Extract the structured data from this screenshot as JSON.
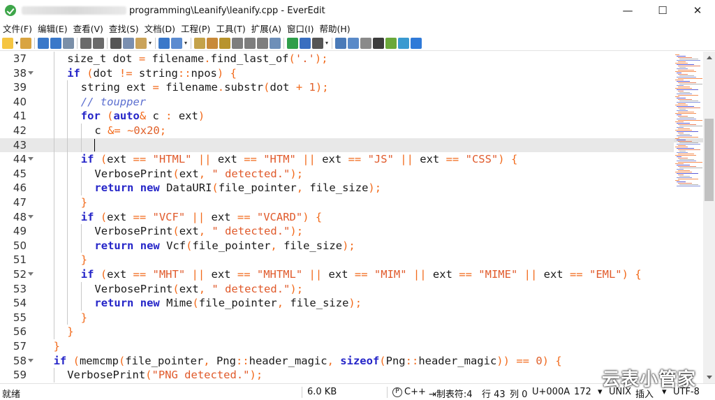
{
  "window": {
    "title": "programming\\Leanify\\leanify.cpp - EverEdit",
    "minimize_glyph": "—",
    "maximize_glyph": "☐",
    "close_glyph": "✕"
  },
  "menu": [
    {
      "label": "文件(F)"
    },
    {
      "label": "编辑(E)"
    },
    {
      "label": "查看(V)"
    },
    {
      "label": "查找(S)"
    },
    {
      "label": "文档(D)"
    },
    {
      "label": "工程(P)"
    },
    {
      "label": "工具(T)"
    },
    {
      "label": "扩展(A)"
    },
    {
      "label": "窗口(I)"
    },
    {
      "label": "帮助(H)"
    }
  ],
  "toolbar_icons": [
    "new-file-icon",
    "open-icon",
    "save-icon",
    "save-all-icon",
    "close-file-icon",
    "undo-icon",
    "redo-icon",
    "cut-icon",
    "copy-icon",
    "paste-icon",
    "indent-icon",
    "list-icon",
    "find-icon",
    "replace-icon",
    "find-in-files-icon",
    "macro-record-icon",
    "macro-play-icon",
    "macro-stop-icon",
    "column-icon",
    "run-icon",
    "run-script-icon",
    "tools-icon",
    "view-icon",
    "split-icon",
    "document-icon",
    "terminal-icon",
    "hex-icon",
    "browser-icon",
    "help-icon"
  ],
  "colors": {
    "keyword": "#2525c8",
    "operator": "#f26a1b",
    "string": "#e05a2b",
    "comment": "#5c6fd0",
    "current_line": "#e8e8e8"
  },
  "code_lines": [
    {
      "n": "37",
      "fold": false,
      "current": false,
      "indent": 2,
      "tokens": [
        [
          "pl",
          "size_t dot "
        ],
        [
          "op",
          "="
        ],
        [
          "pl",
          " filename"
        ],
        [
          "pu",
          "."
        ],
        [
          "fn",
          "find_last_of"
        ],
        [
          "br",
          "("
        ],
        [
          "str",
          "'.'"
        ],
        [
          "br",
          ")"
        ],
        [
          "pu",
          ";"
        ]
      ]
    },
    {
      "n": "38",
      "fold": true,
      "current": false,
      "indent": 2,
      "tokens": [
        [
          "kw",
          "if"
        ],
        [
          "pl",
          " "
        ],
        [
          "br",
          "("
        ],
        [
          "pl",
          "dot "
        ],
        [
          "op",
          "!="
        ],
        [
          "pl",
          " string"
        ],
        [
          "pu",
          "::"
        ],
        [
          "pl",
          "npos"
        ],
        [
          "br",
          ")"
        ],
        [
          "pl",
          " "
        ],
        [
          "br",
          "{"
        ]
      ]
    },
    {
      "n": "39",
      "fold": false,
      "current": false,
      "indent": 3,
      "tokens": [
        [
          "pl",
          "string ext "
        ],
        [
          "op",
          "="
        ],
        [
          "pl",
          " filename"
        ],
        [
          "pu",
          "."
        ],
        [
          "fn",
          "substr"
        ],
        [
          "br",
          "("
        ],
        [
          "pl",
          "dot "
        ],
        [
          "op",
          "+"
        ],
        [
          "pl",
          " "
        ],
        [
          "num",
          "1"
        ],
        [
          "br",
          ")"
        ],
        [
          "pu",
          ";"
        ]
      ]
    },
    {
      "n": "40",
      "fold": false,
      "current": false,
      "indent": 3,
      "tokens": [
        [
          "cm",
          "// toupper"
        ]
      ]
    },
    {
      "n": "41",
      "fold": false,
      "current": false,
      "indent": 3,
      "tokens": [
        [
          "kw",
          "for"
        ],
        [
          "pl",
          " "
        ],
        [
          "br",
          "("
        ],
        [
          "kw",
          "auto"
        ],
        [
          "op",
          "&"
        ],
        [
          "pl",
          " c "
        ],
        [
          "op",
          ":"
        ],
        [
          "pl",
          " ext"
        ],
        [
          "br",
          ")"
        ]
      ]
    },
    {
      "n": "42",
      "fold": false,
      "current": false,
      "indent": 4,
      "tokens": [
        [
          "pl",
          "c "
        ],
        [
          "op",
          "&="
        ],
        [
          "pl",
          " "
        ],
        [
          "op",
          "~"
        ],
        [
          "num",
          "0x20"
        ],
        [
          "pu",
          ";"
        ]
      ]
    },
    {
      "n": "43",
      "fold": false,
      "current": true,
      "indent": 4,
      "tokens": []
    },
    {
      "n": "44",
      "fold": true,
      "current": false,
      "indent": 3,
      "tokens": [
        [
          "kw",
          "if"
        ],
        [
          "pl",
          " "
        ],
        [
          "br",
          "("
        ],
        [
          "pl",
          "ext "
        ],
        [
          "op",
          "=="
        ],
        [
          "pl",
          " "
        ],
        [
          "str",
          "\"HTML\""
        ],
        [
          "pl",
          " "
        ],
        [
          "op",
          "||"
        ],
        [
          "pl",
          " ext "
        ],
        [
          "op",
          "=="
        ],
        [
          "pl",
          " "
        ],
        [
          "str",
          "\"HTM\""
        ],
        [
          "pl",
          " "
        ],
        [
          "op",
          "||"
        ],
        [
          "pl",
          " ext "
        ],
        [
          "op",
          "=="
        ],
        [
          "pl",
          " "
        ],
        [
          "str",
          "\"JS\""
        ],
        [
          "pl",
          " "
        ],
        [
          "op",
          "||"
        ],
        [
          "pl",
          " ext "
        ],
        [
          "op",
          "=="
        ],
        [
          "pl",
          " "
        ],
        [
          "str",
          "\"CSS\""
        ],
        [
          "br",
          ")"
        ],
        [
          "pl",
          " "
        ],
        [
          "br",
          "{"
        ]
      ]
    },
    {
      "n": "45",
      "fold": false,
      "current": false,
      "indent": 4,
      "tokens": [
        [
          "fn",
          "VerbosePrint"
        ],
        [
          "br",
          "("
        ],
        [
          "pl",
          "ext"
        ],
        [
          "pu",
          ","
        ],
        [
          "pl",
          " "
        ],
        [
          "str",
          "\" detected.\""
        ],
        [
          "br",
          ")"
        ],
        [
          "pu",
          ";"
        ]
      ]
    },
    {
      "n": "46",
      "fold": false,
      "current": false,
      "indent": 4,
      "tokens": [
        [
          "kw",
          "return"
        ],
        [
          "pl",
          " "
        ],
        [
          "kw",
          "new"
        ],
        [
          "pl",
          " "
        ],
        [
          "fn",
          "DataURI"
        ],
        [
          "br",
          "("
        ],
        [
          "pl",
          "file_pointer"
        ],
        [
          "pu",
          ","
        ],
        [
          "pl",
          " file_size"
        ],
        [
          "br",
          ")"
        ],
        [
          "pu",
          ";"
        ]
      ]
    },
    {
      "n": "47",
      "fold": false,
      "current": false,
      "indent": 3,
      "tokens": [
        [
          "br",
          "}"
        ]
      ]
    },
    {
      "n": "48",
      "fold": true,
      "current": false,
      "indent": 3,
      "tokens": [
        [
          "kw",
          "if"
        ],
        [
          "pl",
          " "
        ],
        [
          "br",
          "("
        ],
        [
          "pl",
          "ext "
        ],
        [
          "op",
          "=="
        ],
        [
          "pl",
          " "
        ],
        [
          "str",
          "\"VCF\""
        ],
        [
          "pl",
          " "
        ],
        [
          "op",
          "||"
        ],
        [
          "pl",
          " ext "
        ],
        [
          "op",
          "=="
        ],
        [
          "pl",
          " "
        ],
        [
          "str",
          "\"VCARD\""
        ],
        [
          "br",
          ")"
        ],
        [
          "pl",
          " "
        ],
        [
          "br",
          "{"
        ]
      ]
    },
    {
      "n": "49",
      "fold": false,
      "current": false,
      "indent": 4,
      "tokens": [
        [
          "fn",
          "VerbosePrint"
        ],
        [
          "br",
          "("
        ],
        [
          "pl",
          "ext"
        ],
        [
          "pu",
          ","
        ],
        [
          "pl",
          " "
        ],
        [
          "str",
          "\" detected.\""
        ],
        [
          "br",
          ")"
        ],
        [
          "pu",
          ";"
        ]
      ]
    },
    {
      "n": "50",
      "fold": false,
      "current": false,
      "indent": 4,
      "tokens": [
        [
          "kw",
          "return"
        ],
        [
          "pl",
          " "
        ],
        [
          "kw",
          "new"
        ],
        [
          "pl",
          " "
        ],
        [
          "fn",
          "Vcf"
        ],
        [
          "br",
          "("
        ],
        [
          "pl",
          "file_pointer"
        ],
        [
          "pu",
          ","
        ],
        [
          "pl",
          " file_size"
        ],
        [
          "br",
          ")"
        ],
        [
          "pu",
          ";"
        ]
      ]
    },
    {
      "n": "51",
      "fold": false,
      "current": false,
      "indent": 3,
      "tokens": [
        [
          "br",
          "}"
        ]
      ]
    },
    {
      "n": "52",
      "fold": true,
      "current": false,
      "indent": 3,
      "tokens": [
        [
          "kw",
          "if"
        ],
        [
          "pl",
          " "
        ],
        [
          "br",
          "("
        ],
        [
          "pl",
          "ext "
        ],
        [
          "op",
          "=="
        ],
        [
          "pl",
          " "
        ],
        [
          "str",
          "\"MHT\""
        ],
        [
          "pl",
          " "
        ],
        [
          "op",
          "||"
        ],
        [
          "pl",
          " ext "
        ],
        [
          "op",
          "=="
        ],
        [
          "pl",
          " "
        ],
        [
          "str",
          "\"MHTML\""
        ],
        [
          "pl",
          " "
        ],
        [
          "op",
          "||"
        ],
        [
          "pl",
          " ext "
        ],
        [
          "op",
          "=="
        ],
        [
          "pl",
          " "
        ],
        [
          "str",
          "\"MIM\""
        ],
        [
          "pl",
          " "
        ],
        [
          "op",
          "||"
        ],
        [
          "pl",
          " ext "
        ],
        [
          "op",
          "=="
        ],
        [
          "pl",
          " "
        ],
        [
          "str",
          "\"MIME\""
        ],
        [
          "pl",
          " "
        ],
        [
          "op",
          "||"
        ],
        [
          "pl",
          " ext "
        ],
        [
          "op",
          "=="
        ],
        [
          "pl",
          " "
        ],
        [
          "str",
          "\"EML\""
        ],
        [
          "br",
          ")"
        ],
        [
          "pl",
          " "
        ],
        [
          "br",
          "{"
        ]
      ]
    },
    {
      "n": "53",
      "fold": false,
      "current": false,
      "indent": 4,
      "tokens": [
        [
          "fn",
          "VerbosePrint"
        ],
        [
          "br",
          "("
        ],
        [
          "pl",
          "ext"
        ],
        [
          "pu",
          ","
        ],
        [
          "pl",
          " "
        ],
        [
          "str",
          "\" detected.\""
        ],
        [
          "br",
          ")"
        ],
        [
          "pu",
          ";"
        ]
      ]
    },
    {
      "n": "54",
      "fold": false,
      "current": false,
      "indent": 4,
      "tokens": [
        [
          "kw",
          "return"
        ],
        [
          "pl",
          " "
        ],
        [
          "kw",
          "new"
        ],
        [
          "pl",
          " "
        ],
        [
          "fn",
          "Mime"
        ],
        [
          "br",
          "("
        ],
        [
          "pl",
          "file_pointer"
        ],
        [
          "pu",
          ","
        ],
        [
          "pl",
          " file_size"
        ],
        [
          "br",
          ")"
        ],
        [
          "pu",
          ";"
        ]
      ]
    },
    {
      "n": "55",
      "fold": false,
      "current": false,
      "indent": 3,
      "tokens": [
        [
          "br",
          "}"
        ]
      ]
    },
    {
      "n": "56",
      "fold": false,
      "current": false,
      "indent": 2,
      "tokens": [
        [
          "br",
          "}"
        ]
      ]
    },
    {
      "n": "57",
      "fold": false,
      "current": false,
      "indent": 1,
      "tokens": [
        [
          "br",
          "}"
        ]
      ]
    },
    {
      "n": "58",
      "fold": true,
      "current": false,
      "indent": 1,
      "tokens": [
        [
          "kw",
          "if"
        ],
        [
          "pl",
          " "
        ],
        [
          "br",
          "("
        ],
        [
          "fn",
          "memcmp"
        ],
        [
          "br",
          "("
        ],
        [
          "pl",
          "file_pointer"
        ],
        [
          "pu",
          ","
        ],
        [
          "pl",
          " Png"
        ],
        [
          "pu",
          "::"
        ],
        [
          "pl",
          "header_magic"
        ],
        [
          "pu",
          ","
        ],
        [
          "pl",
          " "
        ],
        [
          "kw",
          "sizeof"
        ],
        [
          "br",
          "("
        ],
        [
          "pl",
          "Png"
        ],
        [
          "pu",
          "::"
        ],
        [
          "pl",
          "header_magic"
        ],
        [
          "br",
          "))"
        ],
        [
          "pl",
          " "
        ],
        [
          "op",
          "=="
        ],
        [
          "pl",
          " "
        ],
        [
          "num",
          "0"
        ],
        [
          "br",
          ")"
        ],
        [
          "pl",
          " "
        ],
        [
          "br",
          "{"
        ]
      ]
    },
    {
      "n": "59",
      "fold": false,
      "current": false,
      "indent": 2,
      "tokens": [
        [
          "fn",
          "VerbosePrint"
        ],
        [
          "br",
          "("
        ],
        [
          "str",
          "\"PNG detected.\""
        ],
        [
          "br",
          ")"
        ],
        [
          "pu",
          ";"
        ]
      ]
    }
  ],
  "status": {
    "ready": "就绪",
    "file_size": "6.0 KB",
    "language": "C++",
    "tab": "制表符:4",
    "line": "行 43",
    "col": "列 0",
    "char": "U+000A",
    "char_count": "172",
    "line_ending": "UNIX",
    "insert": "插入",
    "encoding": "UTF-8"
  },
  "watermark": "云表小管家"
}
